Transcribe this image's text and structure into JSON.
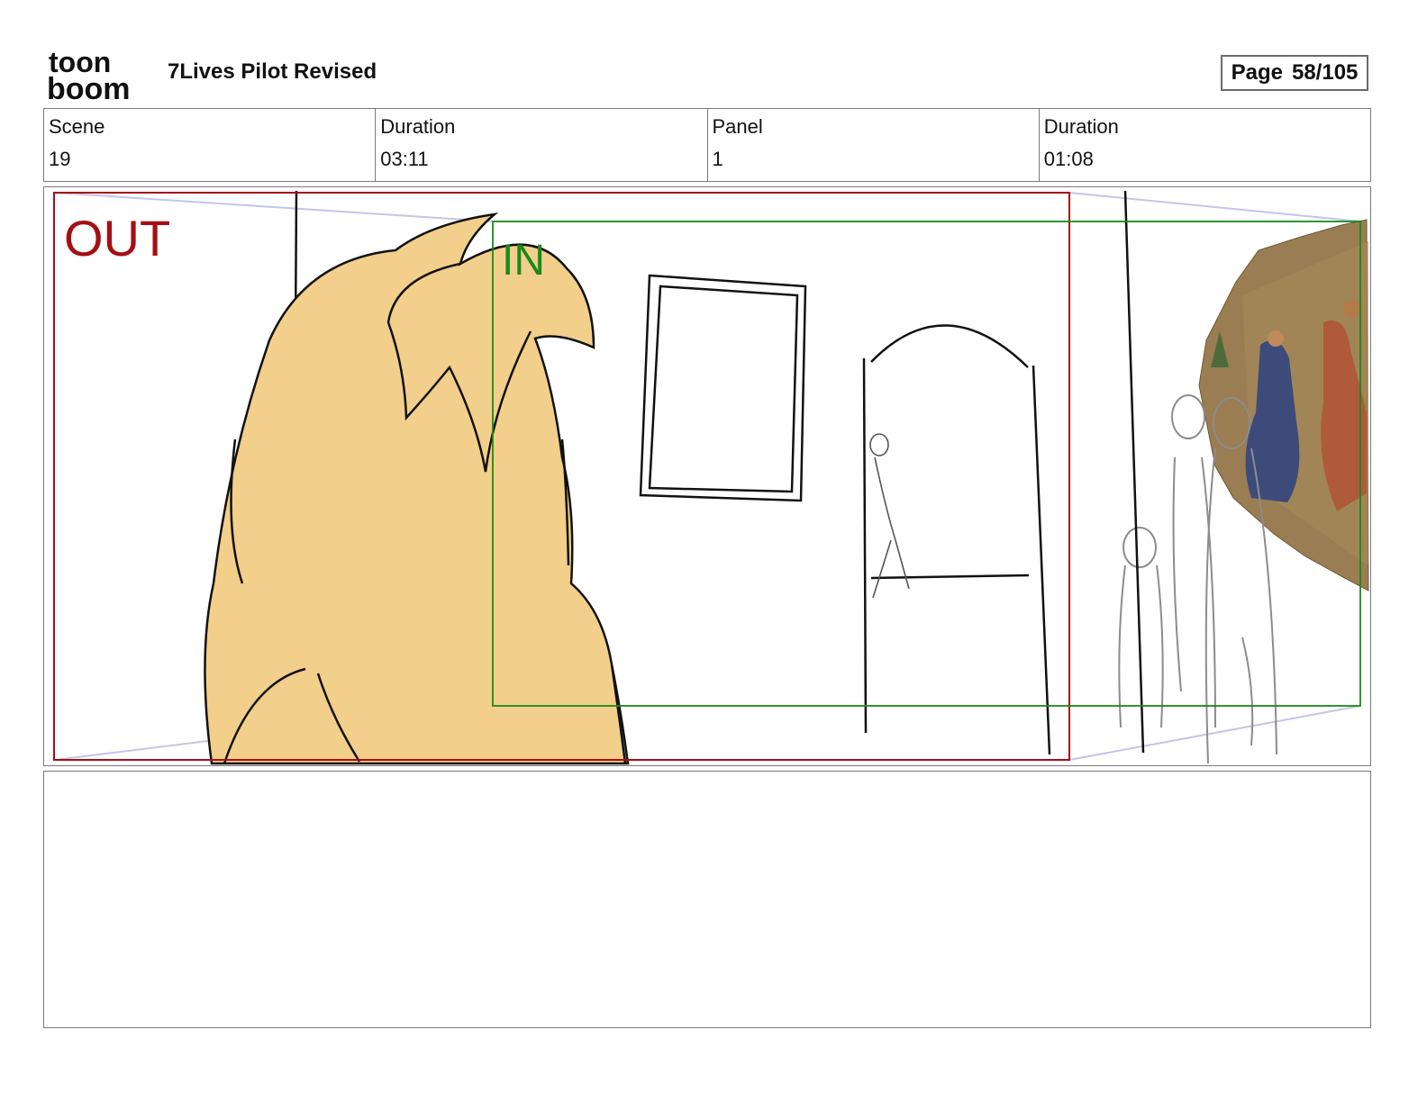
{
  "header": {
    "logo": {
      "line1": "toon",
      "line2": "boom"
    },
    "title": "7Lives Pilot Revised",
    "page_label": "Page",
    "page_value": "58/105"
  },
  "info": {
    "scene_label": "Scene",
    "scene_value": "19",
    "scene_duration_label": "Duration",
    "scene_duration_value": "03:11",
    "panel_label": "Panel",
    "panel_value": "1",
    "panel_duration_label": "Duration",
    "panel_duration_value": "01:08"
  },
  "panel_image": {
    "out_label": "OUT",
    "in_label": "IN",
    "out_color": "#a50f14",
    "in_color": "#1a8a1a",
    "hair_color": "#f2cf8a",
    "guide_color": "#c4c4ea"
  },
  "notes": {
    "text": ""
  }
}
